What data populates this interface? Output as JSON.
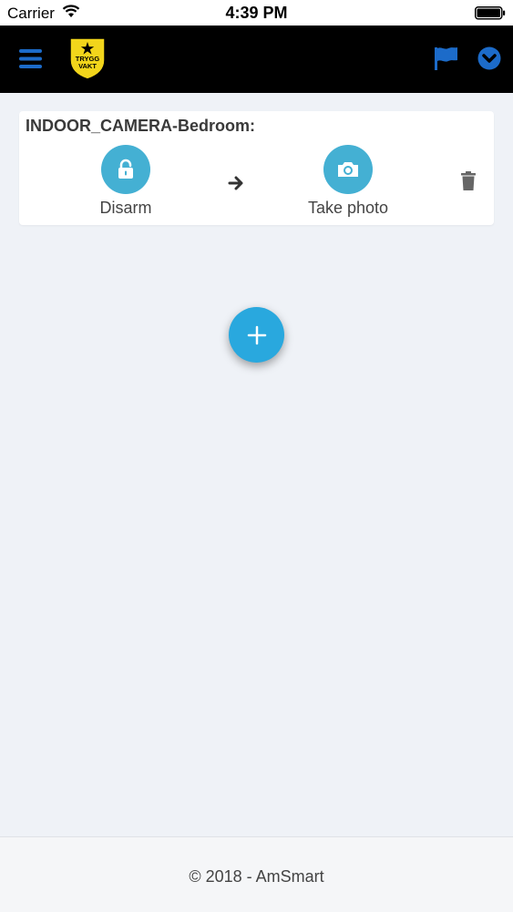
{
  "status_bar": {
    "carrier": "Carrier",
    "time": "4:39 PM"
  },
  "navbar": {
    "logo_text_line1": "TRYGG",
    "logo_text_line2": "VAKT",
    "colors": {
      "background": "#000000",
      "accent": "#1c6bc9",
      "logo_yellow": "#f2d51b"
    }
  },
  "card": {
    "title": "INDOOR_CAMERA-Bedroom:",
    "actions": [
      {
        "label": "Disarm",
        "icon": "unlock-icon"
      },
      {
        "label": "Take photo",
        "icon": "camera-icon"
      }
    ],
    "arrow_icon": "arrow-right-icon",
    "delete_icon": "trash-icon",
    "colors": {
      "action_circle": "#44b0d3"
    }
  },
  "fab": {
    "icon": "plus-icon",
    "color": "#29a8de"
  },
  "footer": {
    "text": "© 2018 - AmSmart"
  }
}
